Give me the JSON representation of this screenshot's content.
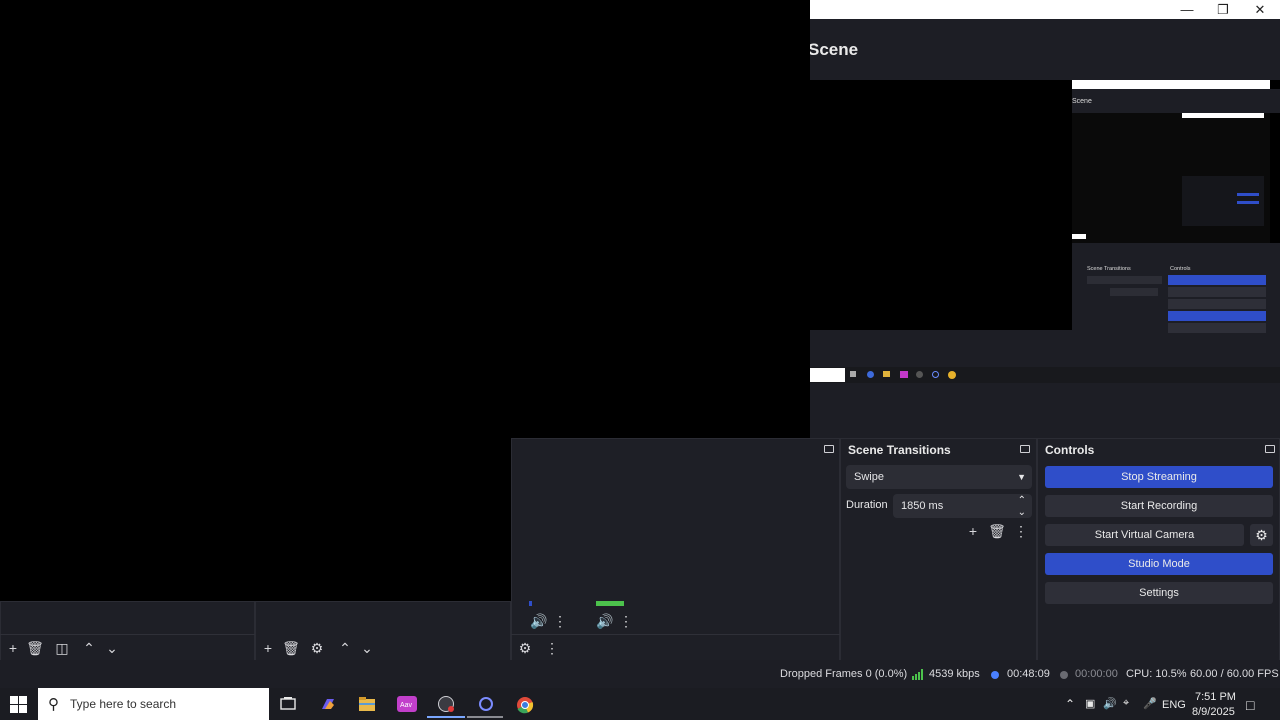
{
  "window": {
    "title": "Scene",
    "controls": [
      "minimize",
      "restore",
      "close"
    ]
  },
  "docks": {
    "scenes_toolbar": [
      "add-icon",
      "trash-icon",
      "filter-icon",
      "up-icon",
      "down-icon"
    ],
    "sources_toolbar": [
      "add-icon",
      "trash-icon",
      "gear-icon",
      "up-icon",
      "down-icon"
    ],
    "scene_transitions": {
      "title": "Scene Transitions",
      "transition": "Swipe",
      "duration_label": "Duration",
      "duration_value": "1850 ms"
    },
    "controls": {
      "title": "Controls",
      "buttons": {
        "stop_streaming": "Stop Streaming",
        "start_recording": "Start Recording",
        "start_virtual_camera": "Start Virtual Camera",
        "studio_mode": "Studio Mode",
        "settings": "Settings"
      }
    }
  },
  "status": {
    "dropped_frames": "Dropped Frames 0 (0.0%)",
    "bitrate": "4539 kbps",
    "stream_time": "00:48:09",
    "record_time": "00:00:00",
    "cpu": "CPU: 10.5%",
    "fps": "60.00 / 60.00 FPS"
  },
  "taskbar": {
    "search_placeholder": "Type here to search",
    "lang": "ENG",
    "time": "7:51 PM",
    "date": "8/9/2025"
  },
  "colors": {
    "accent": "#2f4ec9",
    "panel": "#1e1f26",
    "background": "#1d1e25"
  }
}
